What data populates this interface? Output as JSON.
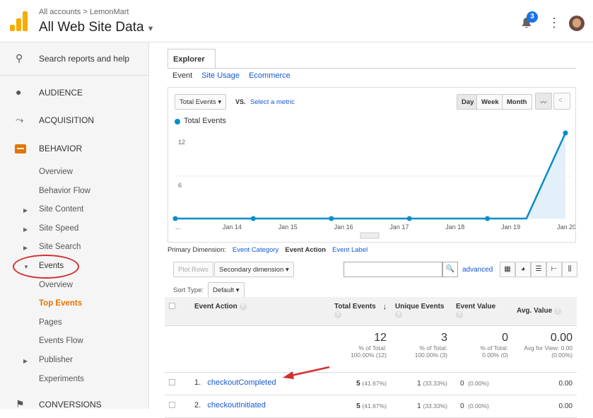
{
  "header": {
    "breadcrumb": "All accounts > LemonMart",
    "view_name": "All Web Site Data",
    "notification_count": "3"
  },
  "sidebar": {
    "search_label": "Search reports and help",
    "audience": "AUDIENCE",
    "acquisition": "ACQUISITION",
    "behavior": "BEHAVIOR",
    "overview": "Overview",
    "behavior_flow": "Behavior Flow",
    "site_content": "Site Content",
    "site_speed": "Site Speed",
    "site_search": "Site Search",
    "events": "Events",
    "events_overview": "Overview",
    "top_events": "Top Events",
    "pages": "Pages",
    "events_flow": "Events Flow",
    "publisher": "Publisher",
    "experiments": "Experiments",
    "conversions": "CONVERSIONS"
  },
  "explorer": {
    "tab": "Explorer",
    "subtabs": [
      "Event",
      "Site Usage",
      "Ecommerce"
    ],
    "metric_select": "Total Events",
    "vs": "VS.",
    "select_metric": "Select a metric",
    "periods": [
      "Day",
      "Week",
      "Month"
    ],
    "legend": "Total Events"
  },
  "chart_data": {
    "type": "line",
    "series": [
      {
        "name": "Total Events",
        "values": [
          0,
          0,
          0,
          0,
          0,
          0,
          0,
          0,
          0,
          0,
          12
        ]
      }
    ],
    "x_tick_labels": [
      "...",
      "Jan 14",
      "Jan 15",
      "Jan 16",
      "Jan 17",
      "Jan 18",
      "Jan 19",
      "Jan 20"
    ],
    "y_ticks": [
      "12",
      "6"
    ],
    "ylim": [
      0,
      12
    ]
  },
  "dimensions": {
    "label": "Primary Dimension:",
    "items": [
      "Event Category",
      "Event Action",
      "Event Label"
    ]
  },
  "controls": {
    "plot_rows": "Plot Rows",
    "secondary_dimension": "Secondary dimension",
    "advanced": "advanced",
    "sort_type_label": "Sort Type:",
    "sort_default": "Default"
  },
  "table": {
    "headers": [
      "Event Action",
      "Total Events",
      "Unique Events",
      "Event Value",
      "Avg. Value"
    ],
    "totals": {
      "total_events": "12",
      "total_events_sub": "% of Total:\n100.00% (12)",
      "unique_events": "3",
      "unique_events_sub": "% of Total:\n100.00% (3)",
      "event_value": "0",
      "event_value_sub": "% of Total:\n0.00% (0)",
      "avg_value": "0.00",
      "avg_value_sub": "Avg for View: 0.00\n(0.00%)"
    },
    "rows": [
      {
        "index": "1.",
        "action": "checkoutCompleted",
        "total": "5",
        "total_pct": "(41.67%)",
        "unique": "1",
        "unique_pct": "(33.33%)",
        "value": "0",
        "value_pct": "(0.00%)",
        "avg": "0.00"
      },
      {
        "index": "2.",
        "action": "checkoutInitiated",
        "total": "5",
        "total_pct": "(41.67%)",
        "unique": "1",
        "unique_pct": "(33.33%)",
        "value": "0",
        "value_pct": "(0.00%)",
        "avg": "0.00"
      }
    ]
  },
  "colors": {
    "accent_orange": "#e37400",
    "link_blue": "#1558d6",
    "chart_blue": "#058dc7",
    "annotation_red": "#d32f2f"
  }
}
